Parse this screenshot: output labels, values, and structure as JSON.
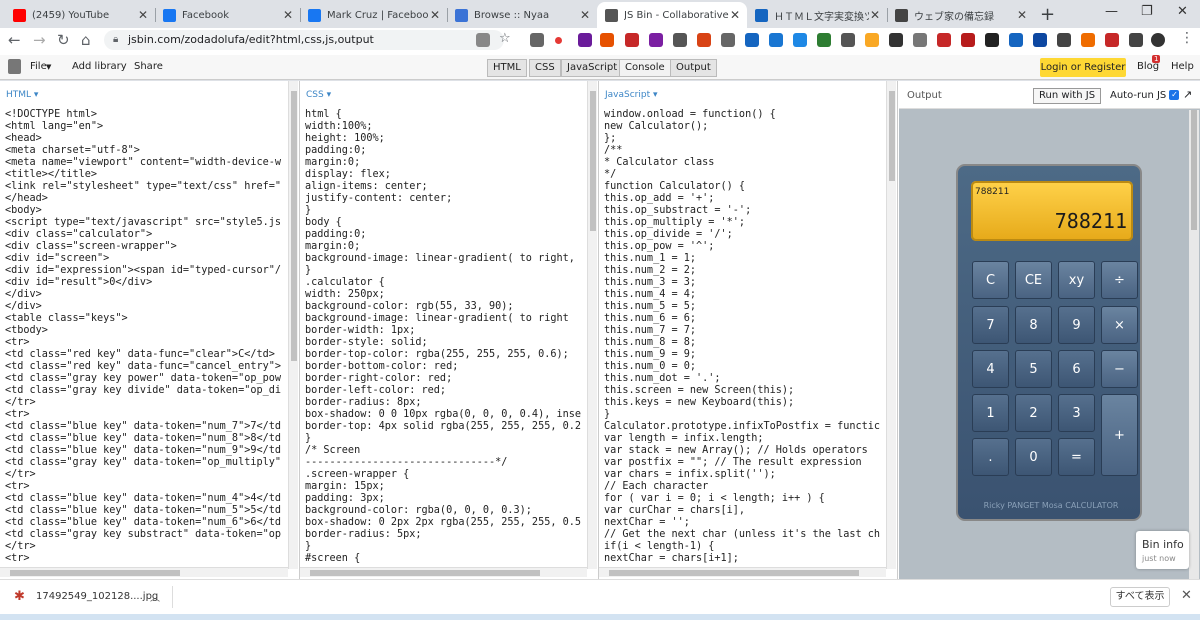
{
  "tabs": [
    {
      "title": "(2459) YouTube",
      "icon": "youtube-icon",
      "color": "#ff0000"
    },
    {
      "title": "Facebook",
      "icon": "facebook-icon",
      "color": "#1877f2"
    },
    {
      "title": "Mark Cruz | Facebook",
      "icon": "facebook-icon",
      "color": "#1877f2"
    },
    {
      "title": "Browse :: Nyaa",
      "icon": "nyaa-icon",
      "color": "#3b73d6"
    },
    {
      "title": "JS Bin - Collaborative JavaScript",
      "icon": "jsbin-icon",
      "color": "#555555"
    },
    {
      "title": "ＨＴＭＬ文字実変換ツール",
      "icon": "t-icon",
      "color": "#1565c0"
    },
    {
      "title": "ウェブ家の備忘録",
      "icon": "info-icon",
      "color": "#444444"
    }
  ],
  "address": {
    "url": "jsbin.com/zodadolufa/edit?html,css,js,output"
  },
  "menu": {
    "file": "File",
    "add_library": "Add library",
    "share": "Share"
  },
  "panel_tabs": [
    "HTML",
    "CSS",
    "JavaScript",
    "Console",
    "Output"
  ],
  "login": "Login or Register",
  "blog": "Blog",
  "blog_badge": "1",
  "help": "Help",
  "panels": {
    "html": {
      "label": "HTML ▾",
      "code": "<!DOCTYPE html>\n<html lang=\"en\">\n<head>\n<meta charset=\"utf-8\">\n<meta name=\"viewport\" content=\"width-device-w\n<title></title>\n<link rel=\"stylesheet\" type=\"text/css\" href=\"\n</head>\n<body>\n<script type=\"text/javascript\" src=\"style5.js\n<div class=\"calculator\">\n<div class=\"screen-wrapper\">\n<div id=\"screen\">\n<div id=\"expression\"><span id=\"typed-cursor\"/\n<div id=\"result\">0</div>\n</div>\n</div>\n<table class=\"keys\">\n<tbody>\n<tr>\n<td class=\"red key\" data-func=\"clear\">C</td>\n<td class=\"red key\" data-func=\"cancel_entry\">\n<td class=\"gray key power\" data-token=\"op_pow\n<td class=\"gray key divide\" data-token=\"op_di\n</tr>\n<tr>\n<td class=\"blue key\" data-token=\"num_7\">7</td\n<td class=\"blue key\" data-token=\"num_8\">8</td\n<td class=\"blue key\" data-token=\"num_9\">9</td\n<td class=\"gray key\" data-token=\"op_multiply\"\n</tr>\n<tr>\n<td class=\"blue key\" data-token=\"num_4\">4</td\n<td class=\"blue key\" data-token=\"num_5\">5</td\n<td class=\"blue key\" data-token=\"num_6\">6</td\n<td class=\"gray key substract\" data-token=\"op\n</tr>\n<tr>"
    },
    "css": {
      "label": "CSS ▾",
      "code": "html {\nwidth:100%;\nheight: 100%;\npadding:0;\nmargin:0;\ndisplay: flex;\nalign-items: center;\njustify-content: center;\n}\nbody {\npadding:0;\nmargin:0;\nbackground-image: linear-gradient( to right,\n}\n.calculator {\nwidth: 250px;\nbackground-color: rgb(55, 33, 90);\nbackground-image: linear-gradient( to right\nborder-width: 1px;\nborder-style: solid;\nborder-top-color: rgba(255, 255, 255, 0.6);\nborder-bottom-color: red;\nborder-right-color: red;\nborder-left-color: red;\nborder-radius: 8px;\nbox-shadow: 0 0 10px rgba(0, 0, 0, 0.4), inse\nborder-top: 4px solid rgba(255, 255, 255, 0.2\n}\n/* Screen\n-------------------------------*/\n.screen-wrapper {\nmargin: 15px;\npadding: 3px;\nbackground-color: rgba(0, 0, 0, 0.3);\nbox-shadow: 0 2px 2px rgba(255, 255, 255, 0.5\nborder-radius: 5px;\n}\n#screen {"
    },
    "js": {
      "label": "JavaScript ▾",
      "code": "window.onload = function() {\nnew Calculator();\n};\n/**\n* Calculator class\n*/\nfunction Calculator() {\nthis.op_add = '+';\nthis.op_substract = '-';\nthis.op_multiply = '*';\nthis.op_divide = '/';\nthis.op_pow = '^';\nthis.num_1 = 1;\nthis.num_2 = 2;\nthis.num_3 = 3;\nthis.num_4 = 4;\nthis.num_5 = 5;\nthis.num_6 = 6;\nthis.num_7 = 7;\nthis.num_8 = 8;\nthis.num_9 = 9;\nthis.num_0 = 0;\nthis.num_dot = '.';\nthis.screen = new Screen(this);\nthis.keys = new Keyboard(this);\n}\nCalculator.prototype.infixToPostfix = functic\nvar length = infix.length;\nvar stack = new Array(); // Holds operators\nvar postfix = \"\"; // The result expression\nvar chars = infix.split('');\n// Each character\nfor ( var i = 0; i < length; i++ ) {\nvar curChar = chars[i],\nnextChar = '';\n// Get the next char (unless it's the last ch\nif(i < length-1) {\nnextChar = chars[i+1];"
    }
  },
  "output": {
    "label": "Output",
    "run": "Run with JS",
    "autorun": "Auto-run JS"
  },
  "calculator": {
    "expression": "788211",
    "result": "788211",
    "keys": [
      "C",
      "CE",
      "xy",
      "÷",
      "7",
      "8",
      "9",
      "×",
      "4",
      "5",
      "6",
      "−",
      "1",
      "2",
      "3",
      "+",
      ".",
      "0",
      "="
    ],
    "brand": "Ricky PANGET Mosa CALCULATOR"
  },
  "bininfo": {
    "title": "Bin info",
    "sub": "just now"
  },
  "download": {
    "file": "17492549_102128....jpg",
    "show_all": "すべて表示"
  }
}
